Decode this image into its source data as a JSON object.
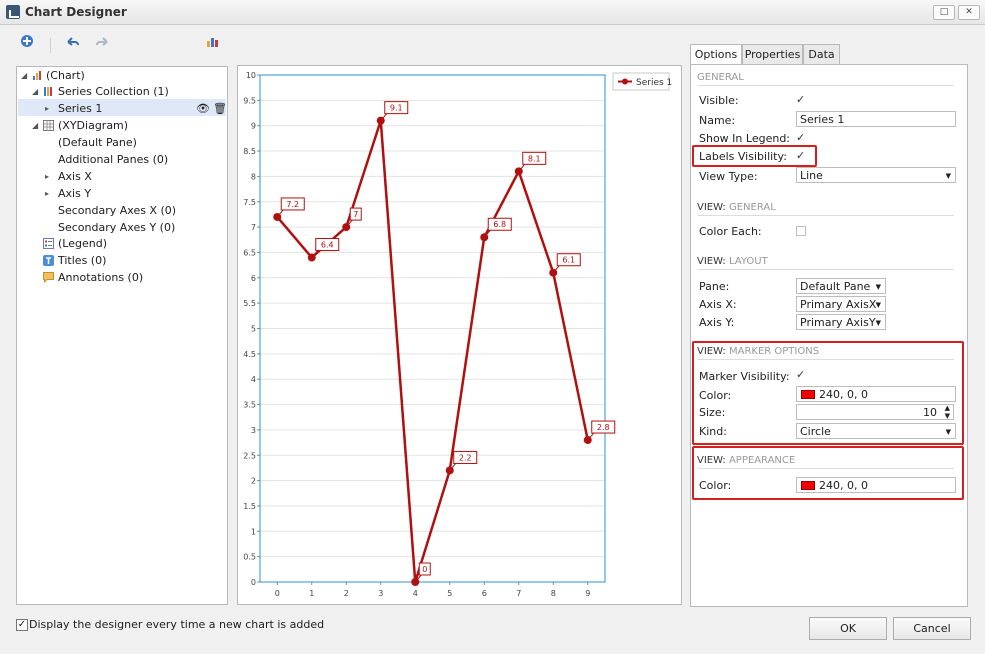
{
  "window": {
    "title": "Chart Designer",
    "restore_label": "□",
    "close_label": "✕"
  },
  "toolbar": {
    "add_icon": "add-series-icon",
    "undo_icon": "undo-icon",
    "redo_icon": "redo-icon",
    "wizard_icon": "chart-wizard-icon"
  },
  "tree": {
    "chart": "(Chart)",
    "series_collection": "Series Collection (1)",
    "series1": "Series 1",
    "xydiagram": "(XYDiagram)",
    "default_pane": "(Default Pane)",
    "additional_panes": "Additional Panes (0)",
    "axis_x": "Axis X",
    "axis_y": "Axis Y",
    "secondary_x": "Secondary Axes X (0)",
    "secondary_y": "Secondary Axes Y (0)",
    "legend": "(Legend)",
    "titles": "Titles (0)",
    "annotations": "Annotations (0)"
  },
  "tabs": {
    "options": "Options",
    "properties": "Properties",
    "data": "Data"
  },
  "options": {
    "general_header": "GENERAL",
    "visible_label": "Visible:",
    "name_label": "Name:",
    "name_value": "Series 1",
    "show_legend_label": "Show In Legend:",
    "labels_visibility_label": "Labels Visibility:",
    "view_type_label": "View Type:",
    "view_type_value": "Line",
    "view_general_prefix": "VIEW:",
    "view_general_suffix": "GENERAL",
    "color_each_label": "Color Each:",
    "view_layout_prefix": "VIEW:",
    "view_layout_suffix": "LAYOUT",
    "pane_label": "Pane:",
    "pane_value": "Default Pane",
    "axis_x_label": "Axis X:",
    "axis_x_value": "Primary AxisX",
    "axis_y_label": "Axis Y:",
    "axis_y_value": "Primary AxisY",
    "marker_prefix": "VIEW:",
    "marker_suffix": "MARKER OPTIONS",
    "marker_visibility_label": "Marker Visibility:",
    "marker_color_label": "Color:",
    "marker_color_value": "240, 0, 0",
    "size_label": "Size:",
    "size_value": "10",
    "kind_label": "Kind:",
    "kind_value": "Circle",
    "appearance_prefix": "VIEW:",
    "appearance_suffix": "APPEARANCE",
    "appearance_color_label": "Color:",
    "appearance_color_value": "240, 0, 0"
  },
  "footer": {
    "display_checkbox_label": "Display the designer every time a new chart is added",
    "ok_label": "OK",
    "cancel_label": "Cancel"
  },
  "colors": {
    "series": "#b01010",
    "marker": "#f00000",
    "highlight": "#d62020"
  },
  "chart_data": {
    "type": "line",
    "x": [
      0,
      1,
      2,
      3,
      4,
      5,
      6,
      7,
      8,
      9
    ],
    "series": [
      {
        "name": "Series 1",
        "values": [
          7.2,
          6.4,
          7,
          9.1,
          0,
          2.2,
          6.8,
          8.1,
          6.1,
          2.8
        ]
      }
    ],
    "xlim": [
      -0.5,
      9.5
    ],
    "ylim": [
      0,
      10
    ],
    "y_ticks": [
      "0",
      "0.5",
      "1",
      "1.5",
      "2",
      "2.5",
      "3",
      "3.5",
      "4",
      "4.5",
      "5",
      "5.5",
      "6",
      "6.5",
      "7",
      "7.5",
      "8",
      "8.5",
      "9",
      "9.5",
      "10"
    ],
    "x_ticks": [
      "0",
      "1",
      "2",
      "3",
      "4",
      "5",
      "6",
      "7",
      "8",
      "9"
    ],
    "legend": "top-right",
    "grid": true,
    "labels": [
      "7.2",
      "6.4",
      "7",
      "9.1",
      "0",
      "2.2",
      "6.8",
      "8.1",
      "6.1",
      "2.8"
    ]
  }
}
